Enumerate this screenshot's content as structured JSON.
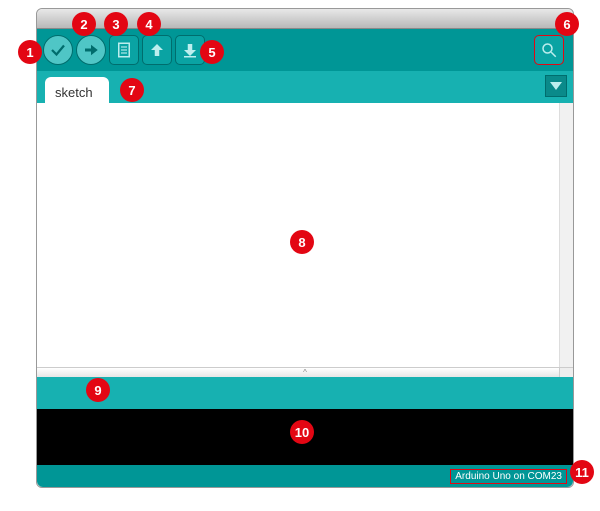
{
  "toolbar": {
    "verify_icon": "verify-icon",
    "upload_icon": "upload-icon",
    "new_icon": "new-icon",
    "open_icon": "open-icon",
    "save_icon": "save-icon",
    "serial_icon": "serial-monitor-icon"
  },
  "tabs": {
    "items": [
      {
        "label": "sketch"
      }
    ],
    "menu_icon": "dropdown-icon"
  },
  "footer": {
    "board_info": "Arduino Uno on COM23"
  },
  "callouts": {
    "c1": "1",
    "c2": "2",
    "c3": "3",
    "c4": "4",
    "c5": "5",
    "c6": "6",
    "c7": "7",
    "c8": "8",
    "c9": "9",
    "c10": "10",
    "c11": "11"
  },
  "colors": {
    "accent": "#009696",
    "accent_light": "#17b1b1",
    "callout": "#e30613"
  }
}
